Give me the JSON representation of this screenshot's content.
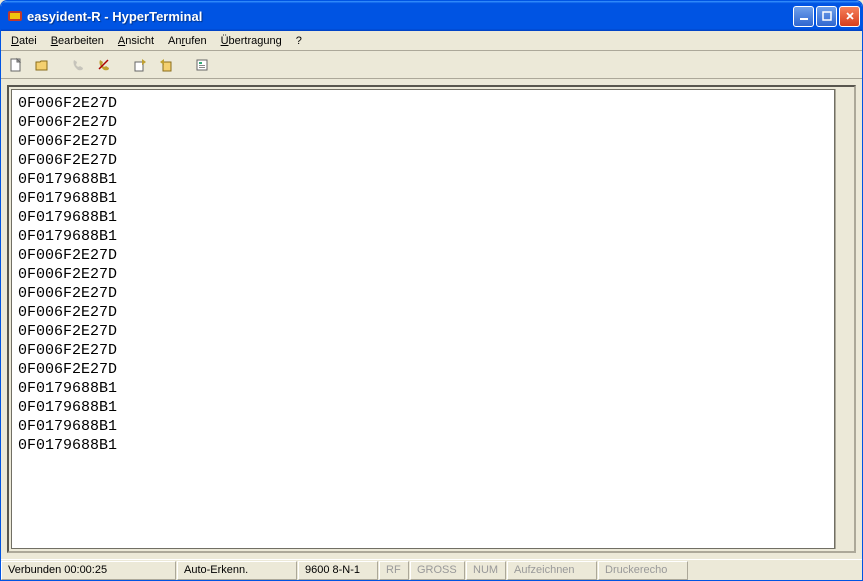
{
  "titlebar": {
    "title": "easyident-R - HyperTerminal"
  },
  "menu": {
    "datei": "Datei",
    "bearbeiten": "Bearbeiten",
    "ansicht": "Ansicht",
    "anrufen": "Anrufen",
    "uebertragung": "Übertragung",
    "help": "?"
  },
  "terminal": {
    "lines": [
      "0F006F2E27D",
      "0F006F2E27D",
      "0F006F2E27D",
      "0F006F2E27D",
      "0F0179688B1",
      "0F0179688B1",
      "0F0179688B1",
      "0F0179688B1",
      "0F006F2E27D",
      "0F006F2E27D",
      "0F006F2E27D",
      "0F006F2E27D",
      "0F006F2E27D",
      "0F006F2E27D",
      "0F006F2E27D",
      "0F0179688B1",
      "0F0179688B1",
      "0F0179688B1",
      "0F0179688B1"
    ]
  },
  "status": {
    "connected": "Verbunden 00:00:25",
    "detect": "Auto-Erkenn.",
    "port": "9600 8-N-1",
    "rf": "RF",
    "caps": "GROSS",
    "num": "NUM",
    "record": "Aufzeichnen",
    "echo": "Druckerecho"
  }
}
